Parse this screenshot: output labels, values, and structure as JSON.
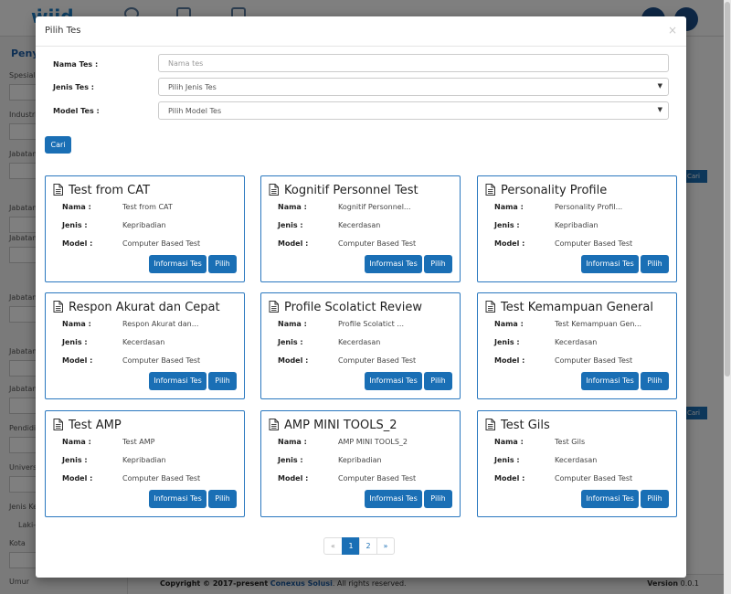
{
  "background": {
    "sidebar_title": "Penyaringan",
    "sidebar_labels": [
      "Spesialisasi",
      "Industri",
      "Jabatan",
      "Jabatan",
      "Jabatan",
      "Jabatan",
      "Jabatan",
      "Jabatan",
      "Pendidikan",
      "Universitas",
      "Jenis Kelamin",
      "Kota",
      "Umur"
    ],
    "gender_option": "Laki-laki",
    "right_button_label": "Cari",
    "footer": {
      "copyright": "Copyright © 2017-present",
      "brand": "Conexus Solusi",
      "rights": ". All rights reserved.",
      "version_label": "Version",
      "version_value": "0.0.1"
    }
  },
  "modal": {
    "title": "Pilih Tes",
    "close": "×",
    "form": {
      "nama_label": "Nama Tes :",
      "nama_placeholder": "Nama tes",
      "jenis_label": "Jenis Tes :",
      "jenis_value": "Pilih Jenis Tes",
      "model_label": "Model Tes :",
      "model_value": "Pilih Model Tes",
      "search_button": "Cari"
    },
    "field_labels": {
      "nama": "Nama :",
      "jenis": "Jenis :",
      "model": "Model :"
    },
    "buttons": {
      "info": "Informasi Tes",
      "pilih": "Pilih"
    },
    "tests": [
      {
        "title": "Test from CAT",
        "nama": "Test from CAT",
        "jenis": "Kepribadian",
        "model": "Computer Based Test"
      },
      {
        "title": "Kognitif Personnel Test",
        "nama": "Kognitif Personnel...",
        "jenis": "Kecerdasan",
        "model": "Computer Based Test"
      },
      {
        "title": "Personality Profile",
        "nama": "Personality Profil...",
        "jenis": "Kepribadian",
        "model": "Computer Based Test"
      },
      {
        "title": "Respon Akurat dan Cepat",
        "nama": "Respon Akurat dan...",
        "jenis": "Kecerdasan",
        "model": "Computer Based Test"
      },
      {
        "title": "Profile Scolatict Review",
        "nama": "Profile Scolatict ...",
        "jenis": "Kecerdasan",
        "model": "Computer Based Test"
      },
      {
        "title": "Test Kemampuan General",
        "nama": "Test Kemampuan Gen...",
        "jenis": "Kecerdasan",
        "model": "Computer Based Test"
      },
      {
        "title": "Test AMP",
        "nama": "Test AMP",
        "jenis": "Kepribadian",
        "model": "Computer Based Test"
      },
      {
        "title": "AMP MINI TOOLS_2",
        "nama": "AMP MINI TOOLS_2",
        "jenis": "Kepribadian",
        "model": "Computer Based Test"
      },
      {
        "title": "Test Gils",
        "nama": "Test Gils",
        "jenis": "Kecerdasan",
        "model": "Computer Based Test"
      }
    ],
    "pagination": {
      "prev": "«",
      "pages": [
        "1",
        "2"
      ],
      "active": "1",
      "next": "»"
    }
  },
  "colors": {
    "primary": "#1a6fb5",
    "card_border": "#2a78bf",
    "overlay": "rgba(0,0,0,0.5)"
  }
}
